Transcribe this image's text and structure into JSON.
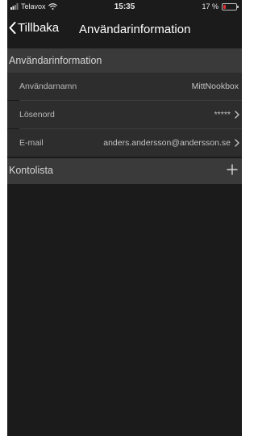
{
  "status_bar": {
    "carrier": "Telavox",
    "time": "15:35",
    "battery_text": "17 %",
    "battery_level": 0.17,
    "battery_color": "#e03030",
    "icons": [
      "signal-icon",
      "wifi-icon",
      "battery-icon"
    ]
  },
  "navbar": {
    "back_label": "Tillbaka",
    "title": "Användarinformation"
  },
  "user_info_section": {
    "header": "Användarinformation",
    "rows": [
      {
        "label": "Användarnamn",
        "value": "MittNookbox"
      },
      {
        "label": "Lösenord",
        "value": "*****"
      },
      {
        "label": "E-mail",
        "value": "anders.andersson@andersson.se"
      }
    ]
  },
  "account_list_section": {
    "header": "Kontolista",
    "add_icon": "plus-icon"
  },
  "colors": {
    "background": "#1b1b1b",
    "section_header": "#3a3a3a",
    "row": "#2d2d2d"
  }
}
